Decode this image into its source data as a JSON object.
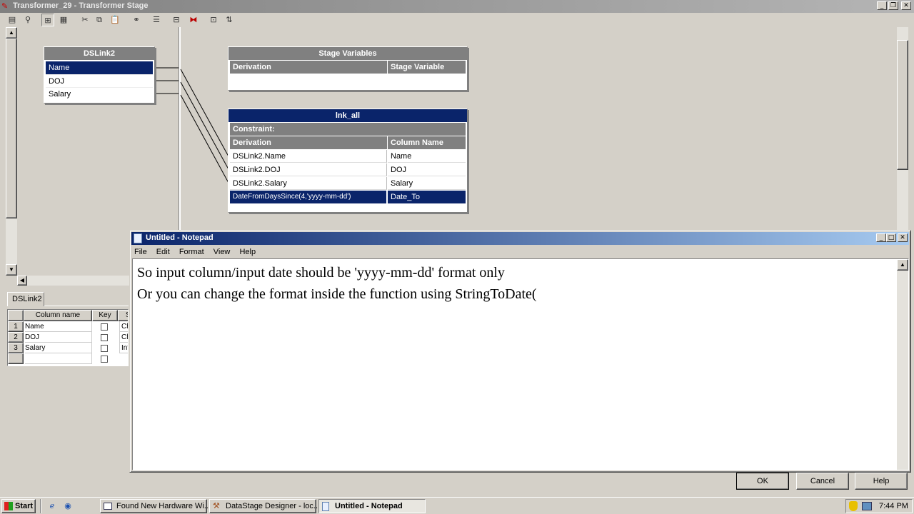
{
  "app": {
    "title": "Transformer_29 - Transformer Stage"
  },
  "input_link": {
    "title": "DSLink2",
    "columns": [
      "Name",
      "DOJ",
      "Salary"
    ]
  },
  "stage_variables": {
    "title": "Stage Variables",
    "col_derivation": "Derivation",
    "col_variable": "Stage Variable"
  },
  "output_link": {
    "title": "lnk_all",
    "constraint_label": "Constraint:",
    "col_derivation": "Derivation",
    "col_column": "Column Name",
    "rows": [
      {
        "derivation": "DSLink2.Name",
        "column": "Name"
      },
      {
        "derivation": "DSLink2.DOJ",
        "column": "DOJ"
      },
      {
        "derivation": "DSLink2.Salary",
        "column": "Salary"
      },
      {
        "derivation": "DateFromDaysSince(4,'yyyy-mm-dd')",
        "column": "Date_To"
      }
    ]
  },
  "meta_panel": {
    "tab": "DSLink2",
    "headers": [
      "Column name",
      "Key",
      "S"
    ],
    "rows": [
      {
        "num": "1",
        "name": "Name",
        "type": "Char"
      },
      {
        "num": "2",
        "name": "DOJ",
        "type": "Char"
      },
      {
        "num": "3",
        "name": "Salary",
        "type": "Integ"
      }
    ]
  },
  "notepad": {
    "title": "Untitled - Notepad",
    "menu": [
      "File",
      "Edit",
      "Format",
      "View",
      "Help"
    ],
    "lines": [
      "So input column/input date should be 'yyyy-mm-dd' format only",
      "Or you can change the format inside the function using StringToDate("
    ]
  },
  "dialog_buttons": {
    "ok": "OK",
    "cancel": "Cancel",
    "help": "Help"
  },
  "taskbar": {
    "start": "Start",
    "tasks": [
      "Found New Hardware Wi...",
      "DataStage Designer - loc...",
      "Untitled - Notepad"
    ],
    "clock": "7:44 PM"
  },
  "colors": {
    "navy": "#0a246a",
    "face": "#d4d0c8",
    "header_grey": "#808080"
  }
}
